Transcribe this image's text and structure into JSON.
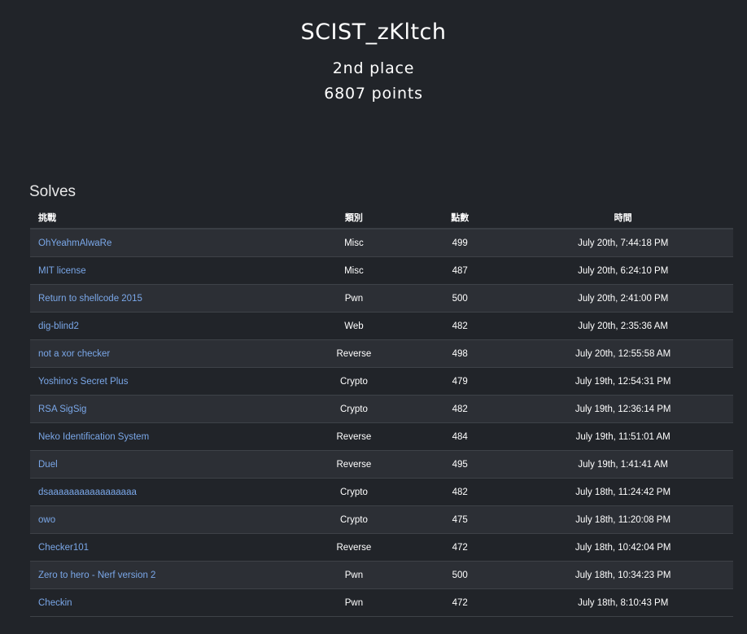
{
  "team": {
    "name": "SCIST_zKltch",
    "place": "2nd place",
    "points": "6807 points"
  },
  "solves": {
    "title": "Solves",
    "headers": {
      "challenge": "挑戰",
      "category": "類別",
      "value": "點數",
      "time": "時間"
    },
    "rows": [
      {
        "name": "OhYeahmAlwaRe",
        "category": "Misc",
        "value": "499",
        "time": "July 20th, 7:44:18 PM"
      },
      {
        "name": "MIT license",
        "category": "Misc",
        "value": "487",
        "time": "July 20th, 6:24:10 PM"
      },
      {
        "name": "Return to shellcode 2015",
        "category": "Pwn",
        "value": "500",
        "time": "July 20th, 2:41:00 PM"
      },
      {
        "name": "dig-blind2",
        "category": "Web",
        "value": "482",
        "time": "July 20th, 2:35:36 AM"
      },
      {
        "name": "not a xor checker",
        "category": "Reverse",
        "value": "498",
        "time": "July 20th, 12:55:58 AM"
      },
      {
        "name": "Yoshino's Secret Plus",
        "category": "Crypto",
        "value": "479",
        "time": "July 19th, 12:54:31 PM"
      },
      {
        "name": "RSA SigSig",
        "category": "Crypto",
        "value": "482",
        "time": "July 19th, 12:36:14 PM"
      },
      {
        "name": "Neko Identification System",
        "category": "Reverse",
        "value": "484",
        "time": "July 19th, 11:51:01 AM"
      },
      {
        "name": "Duel",
        "category": "Reverse",
        "value": "495",
        "time": "July 19th, 1:41:41 AM"
      },
      {
        "name": "dsaaaaaaaaaaaaaaaaa",
        "category": "Crypto",
        "value": "482",
        "time": "July 18th, 11:24:42 PM"
      },
      {
        "name": "owo",
        "category": "Crypto",
        "value": "475",
        "time": "July 18th, 11:20:08 PM"
      },
      {
        "name": "Checker101",
        "category": "Reverse",
        "value": "472",
        "time": "July 18th, 10:42:04 PM"
      },
      {
        "name": "Zero to hero - Nerf version 2",
        "category": "Pwn",
        "value": "500",
        "time": "July 18th, 10:34:23 PM"
      },
      {
        "name": "Checkin",
        "category": "Pwn",
        "value": "472",
        "time": "July 18th, 8:10:43 PM"
      }
    ]
  },
  "colors": {
    "background": "#212429",
    "row_alt": "#2c2f35",
    "link": "#7aa7e8"
  }
}
